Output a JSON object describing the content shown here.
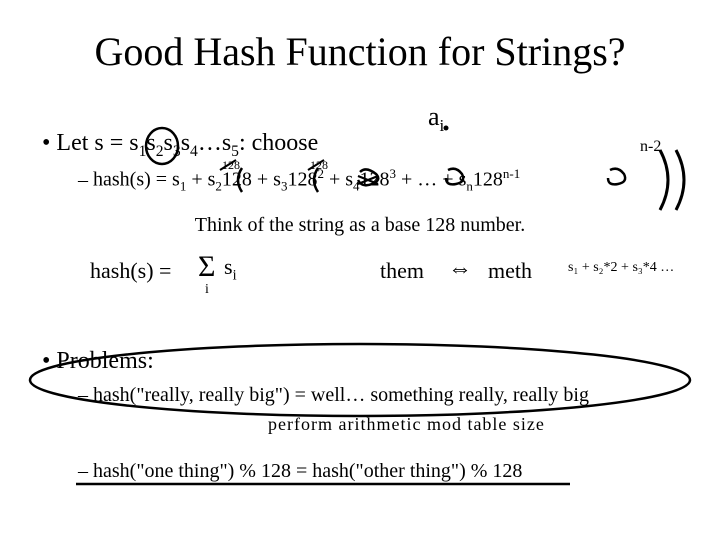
{
  "title": "Good Hash Function for Strings?",
  "line_let": "Let s = s",
  "let_sub1": "1",
  "let_s2": "s",
  "let_sub2": "2",
  "let_s3": "s",
  "let_sub3": "3",
  "let_s4": "s",
  "let_sub4": "4",
  "let_dots": "…s",
  "let_sub5": "5",
  "let_tail": ": choose",
  "hash_lead": "hash(s) = s",
  "h_sub1": "1",
  "h_plus1": " + s",
  "h_sub2": "2",
  "h_128a": "128 + s",
  "h_sub3": "3",
  "h_128b": "128",
  "h_sup2": "2",
  "h_plus_s4": " + s",
  "h_sub4": "4",
  "h_128c": "128",
  "h_sup3": "3",
  "h_mid": " + … + s",
  "h_subn": "n",
  "h_128d": "128",
  "h_supn": "n-1",
  "think": "Think of the string as a base 128 number.",
  "problems": "Problems:",
  "prob1": "hash(\"really, really big\") = well… something really, really big",
  "prob2": "hash(\"one thing\") % 128 = hash(\"other thing\") % 128",
  "hand_ai": "a",
  "hand_ai_sub": "i",
  "hand_n2": "n-2",
  "hand_128_left": "128",
  "hand_128_mid": "128",
  "hand_hash": "hash(s) =",
  "hand_sigma": "Σ",
  "hand_sigma_idx": "i",
  "hand_si": "s",
  "hand_si_sub": "i",
  "hand_them": "them",
  "hand_arrow": "⇔",
  "hand_meth": "meth",
  "hand_expand": "s₁ + s₂*2 + s₃*4 …",
  "hand_perform": "perform  arithmetic  mod  table size"
}
